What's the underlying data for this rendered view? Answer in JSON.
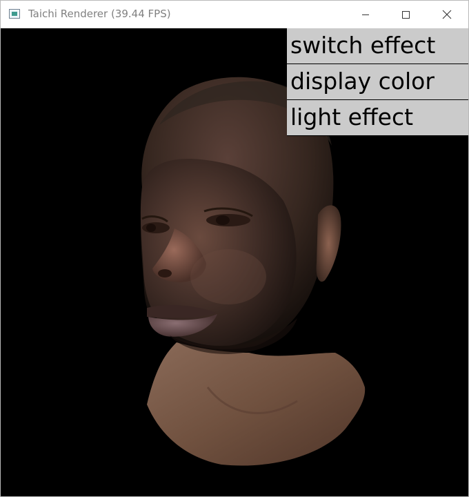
{
  "window": {
    "title": "Taichi Renderer (39.44 FPS)",
    "controls": {
      "minimize": "minimize-icon",
      "maximize": "maximize-icon",
      "close": "close-icon"
    }
  },
  "canvas": {
    "background": "#000000",
    "render": "3D head model (skin-textured face)"
  },
  "gui": {
    "buttons": [
      {
        "label": "switch effect"
      },
      {
        "label": "display color"
      },
      {
        "label": "light effect"
      }
    ],
    "button_bg": "#cbcbcb"
  }
}
